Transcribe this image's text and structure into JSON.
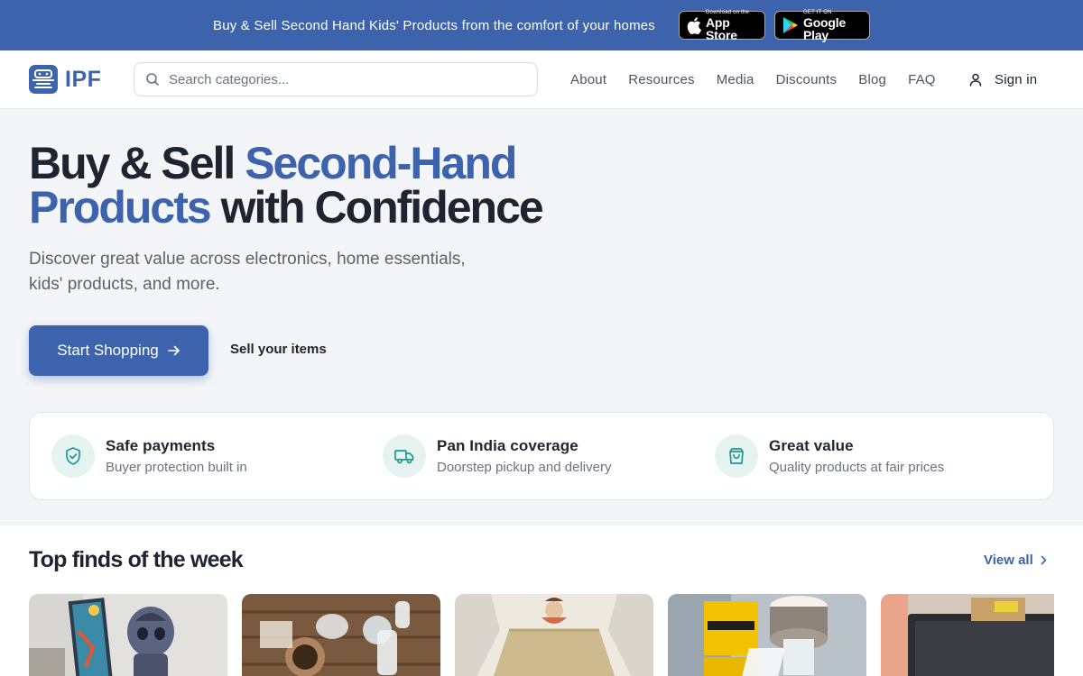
{
  "banner": {
    "text": "Buy & Sell Second Hand Kids' Products from the comfort of your homes",
    "app_store": {
      "small": "Download on the",
      "big": "App Store"
    },
    "google_play": {
      "small": "GET IT ON",
      "big": "Google Play"
    }
  },
  "header": {
    "logo_text": "IPF",
    "search_placeholder": "Search categories...",
    "nav": [
      "About",
      "Resources",
      "Media",
      "Discounts",
      "Blog",
      "FAQ"
    ],
    "sign_in": "Sign in"
  },
  "hero": {
    "title_part1": "Buy & Sell ",
    "title_accent": "Second-Hand Products",
    "title_part2": " with Confidence",
    "subtitle": "Discover great value across electronics, home essentials, kids' products, and more.",
    "cta_primary": "Start Shopping",
    "cta_secondary": "Sell your items"
  },
  "features": [
    {
      "title": "Safe payments",
      "desc": "Buyer protection built in",
      "icon": "shield-check-icon"
    },
    {
      "title": "Pan India coverage",
      "desc": "Doorstep pickup and delivery",
      "icon": "truck-icon"
    },
    {
      "title": "Great value",
      "desc": "Quality products at fair prices",
      "icon": "shopping-bag-icon"
    }
  ],
  "top_finds": {
    "title": "Top finds of the week",
    "view_all": "View all",
    "products": [
      {
        "name": "toy-figure-product"
      },
      {
        "name": "breast-pump-parts-product"
      },
      {
        "name": "kids-dress-product"
      },
      {
        "name": "medela-pump-product"
      },
      {
        "name": "laptop-product"
      }
    ]
  },
  "colors": {
    "brand": "#3d63ad",
    "feature_icon_bg": "#e5f3f1",
    "feature_icon": "#1f9a8a"
  }
}
